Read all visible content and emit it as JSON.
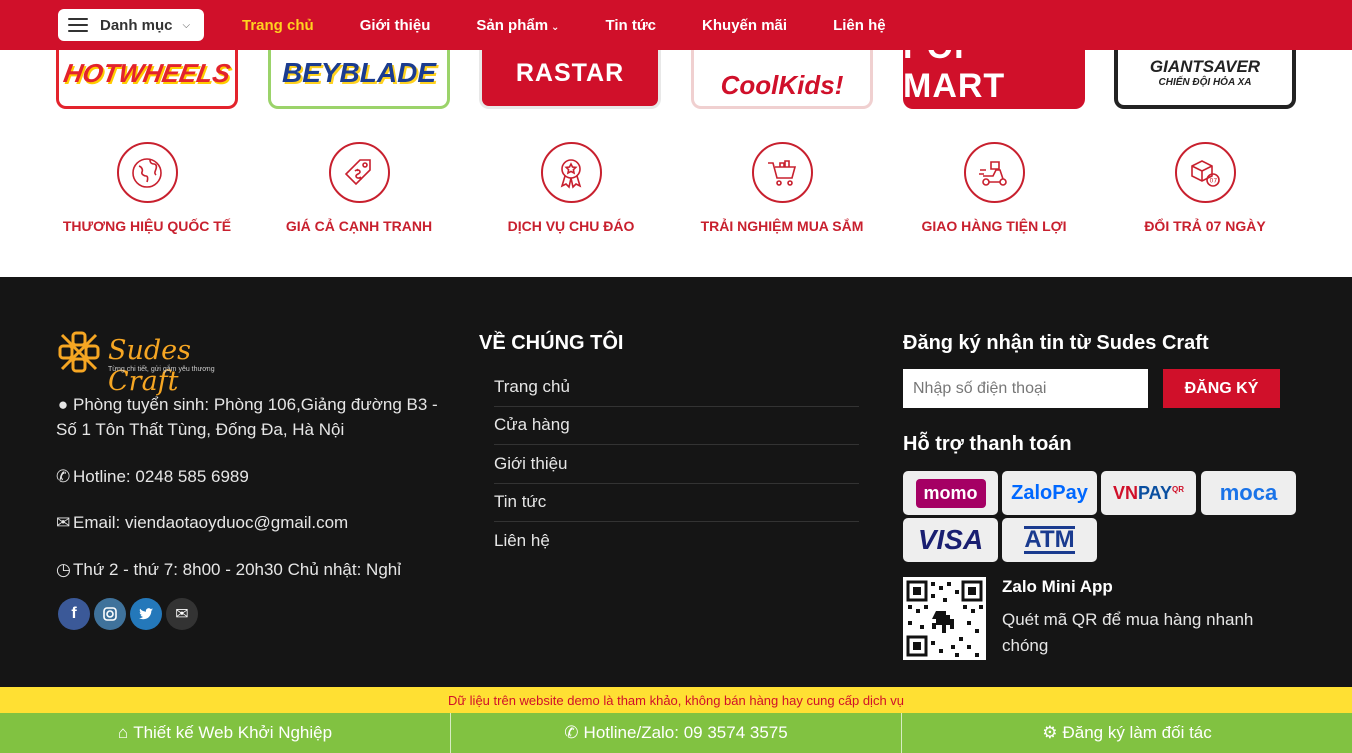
{
  "header": {
    "category_label": "Danh mục",
    "nav": [
      "Trang chủ",
      "Giới thiệu",
      "Sản phẩm",
      "Tin tức",
      "Khuyến mãi",
      "Liên hệ"
    ],
    "active_color": "#ffd21f",
    "brand_color": "#d0102a"
  },
  "brands": {
    "hotwheels": "HOTWHEELS",
    "beyblade": "BEYBLADE",
    "rastar": "RASTAR",
    "coolkids": "CoolKids!",
    "popmart": "POP MART",
    "giantsaver": "GIANTSAVER",
    "giantsaver_sub": "CHIẾN ĐỘI HỎA XA"
  },
  "features": [
    {
      "label": "THƯƠNG HIỆU QUỐC TẾ",
      "icon": "globe-icon"
    },
    {
      "label": "GIÁ CẢ CẠNH TRANH",
      "icon": "price-tag-icon"
    },
    {
      "label": "DỊCH VỤ CHU ĐÁO",
      "icon": "badge-icon"
    },
    {
      "label": "TRẢI NGHIỆM MUA SẮM",
      "icon": "shopping-cart-icon"
    },
    {
      "label": "GIAO HÀNG TIỆN LỢI",
      "icon": "delivery-icon"
    },
    {
      "label": "ĐỔI TRẢ 07 NGÀY",
      "icon": "return-box-icon"
    }
  ],
  "footer": {
    "logo_text": "Sudes Craft",
    "logo_tagline": "Từng chi tiết, gửi gắm yêu thương",
    "address": "Phòng tuyển sinh: Phòng 106,Giảng đường B3 - Số 1 Tôn Thất Tùng, Đống Đa, Hà Nội",
    "hotline": "Hotline: 0248 585 6989",
    "email": "Email: viendaotaoyduoc@gmail.com",
    "hours": "Thứ 2 - thứ 7: 8h00 - 20h30 Chủ nhật: Nghỉ",
    "about_title": "VỀ CHÚNG TÔI",
    "about_links": [
      "Trang chủ",
      "Cửa hàng",
      "Giới thiệu",
      "Tin tức",
      "Liên hệ"
    ],
    "subscribe_title": "Đăng ký nhận tin từ Sudes Craft",
    "phone_placeholder": "Nhập số điện thoại",
    "subscribe_button": "ĐĂNG KÝ",
    "payment_title": "Hỗ trợ thanh toán",
    "payments": [
      "momo",
      "ZaloPay",
      "VNPAY",
      "moca",
      "VISA",
      "ATM"
    ],
    "zalo_title": "Zalo Mini App",
    "zalo_desc": "Quét mã QR để mua hàng nhanh chóng"
  },
  "notice": "Dữ liệu trên website demo là tham khảo, không bán hàng hay cung cấp dịch vụ",
  "bottom_bar": [
    {
      "label": "Thiết kế Web Khởi Nghiệp",
      "icon": "home-icon"
    },
    {
      "label": "Hotline/Zalo: 09 3574 3575",
      "icon": "phone-icon"
    },
    {
      "label": "Đăng ký làm đối tác",
      "icon": "gear-icon"
    }
  ]
}
